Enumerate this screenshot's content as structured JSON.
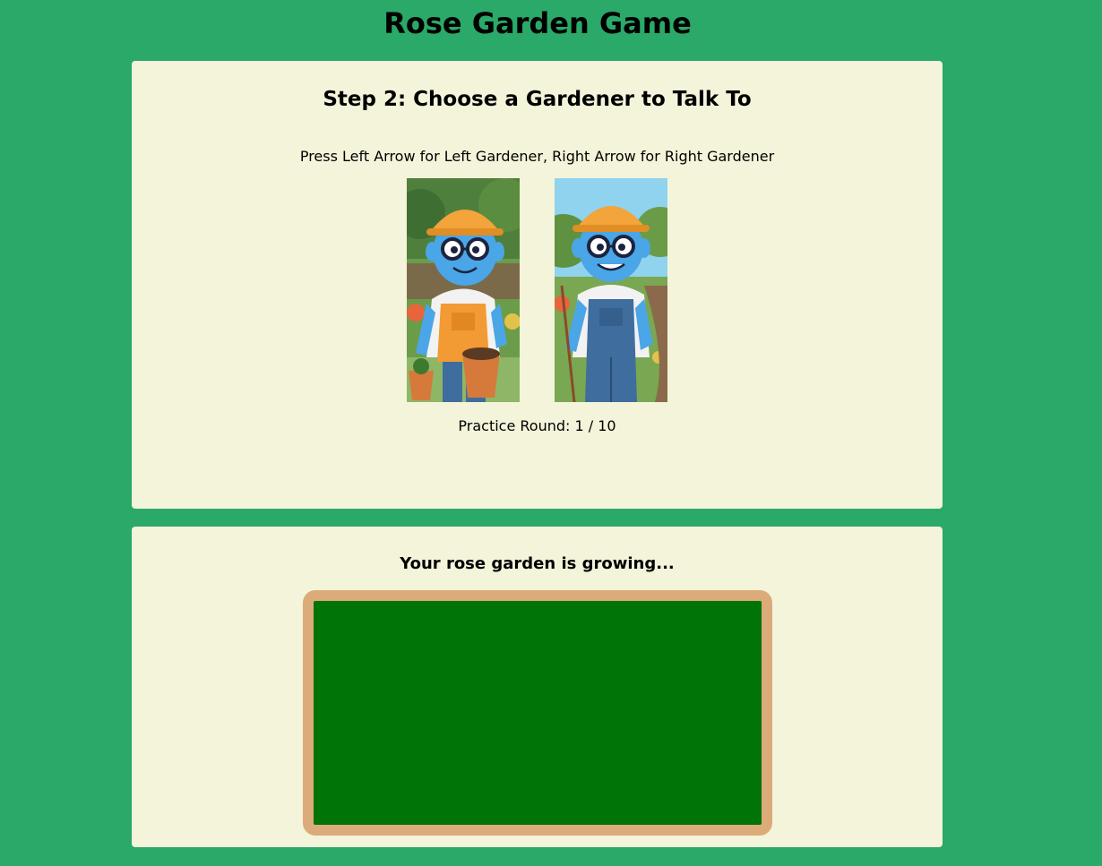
{
  "page": {
    "title": "Rose Garden Game"
  },
  "choice_panel": {
    "step_title": "Step 2: Choose a Gardener to Talk To",
    "instructions": "Press Left Arrow for Left Gardener, Right Arrow for Right Gardener",
    "practice_round_label": "Practice Round:",
    "practice_round_current": 1,
    "practice_round_total": 10,
    "practice_round_text": "Practice Round: 1 / 10"
  },
  "garden_panel": {
    "status_text": "Your rose garden is growing..."
  },
  "colors": {
    "background": "#2aa968",
    "panel": "#f4f4da",
    "garden_border": "#dcab7a",
    "garden_soil": "#007407",
    "gardener_skin": "#4aa6e6",
    "left_overalls": "#f29a33",
    "right_overalls": "#3f6d9e",
    "hat": "#f3a43a"
  }
}
